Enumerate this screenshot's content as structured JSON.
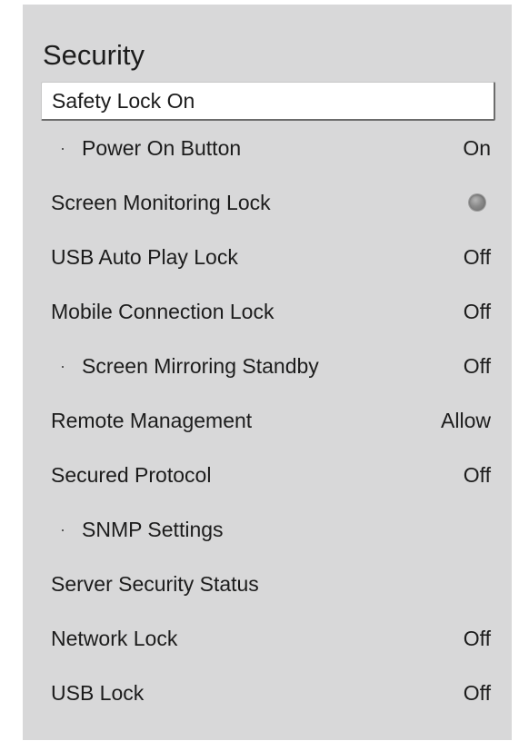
{
  "title": "Security",
  "items": [
    {
      "label": "Safety Lock On",
      "value": ""
    },
    {
      "label": "Power On Button",
      "value": "On"
    },
    {
      "label": "Screen Monitoring Lock",
      "value": ""
    },
    {
      "label": "USB Auto Play Lock",
      "value": "Off"
    },
    {
      "label": "Mobile Connection Lock",
      "value": "Off"
    },
    {
      "label": "Screen Mirroring Standby",
      "value": "Off"
    },
    {
      "label": "Remote Management",
      "value": "Allow"
    },
    {
      "label": "Secured Protocol",
      "value": "Off"
    },
    {
      "label": "SNMP Settings",
      "value": ""
    },
    {
      "label": "Server Security Status",
      "value": ""
    },
    {
      "label": "Network Lock",
      "value": "Off"
    },
    {
      "label": "USB Lock",
      "value": "Off"
    }
  ],
  "bullet_glyph": "·",
  "screen_monitoring_toggle": {
    "state": "off",
    "icon": "radio-toggle-icon"
  },
  "colors": {
    "panel_background": "#d8d8d9",
    "focus_background": "#ffffff",
    "text": "#1c1c1c"
  }
}
